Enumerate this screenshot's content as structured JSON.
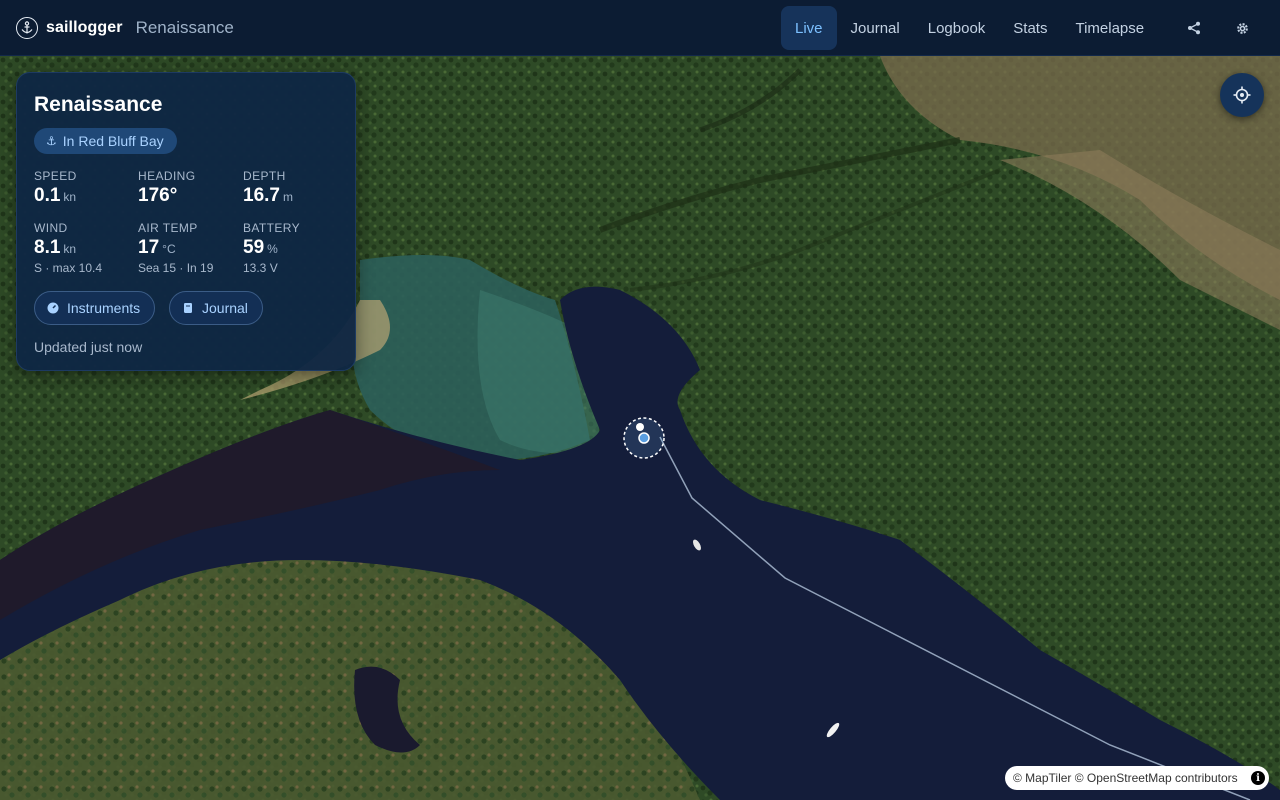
{
  "app": {
    "brand": "saillogger",
    "boat_name": "Renaissance"
  },
  "nav": {
    "items": [
      {
        "label": "Live",
        "active": true
      },
      {
        "label": "Journal",
        "active": false
      },
      {
        "label": "Logbook",
        "active": false
      },
      {
        "label": "Stats",
        "active": false
      },
      {
        "label": "Timelapse",
        "active": false
      }
    ],
    "icons": [
      "share-icon",
      "settings-icon"
    ]
  },
  "card": {
    "title": "Renaissance",
    "status": "In Red Bluff Bay",
    "metrics": {
      "speed": {
        "label": "SPEED",
        "value": "0.1",
        "unit": "kn"
      },
      "heading": {
        "label": "HEADING",
        "value": "176°",
        "unit": ""
      },
      "depth": {
        "label": "DEPTH",
        "value": "16.7",
        "unit": "m"
      },
      "wind": {
        "label": "WIND",
        "value": "8.1",
        "unit": "kn",
        "sub": "S · max 10.4"
      },
      "air_temp": {
        "label": "AIR TEMP",
        "value": "17",
        "unit": "°C",
        "sub": "Sea 15 · In 19"
      },
      "battery": {
        "label": "BATTERY",
        "value": "59",
        "unit": "%",
        "sub": "13.3 V"
      }
    },
    "buttons": {
      "instruments": "Instruments",
      "journal": "Journal"
    },
    "updated": "Updated just now"
  },
  "map": {
    "attribution": "© MapTiler © OpenStreetMap contributors",
    "locate_icon": "crosshair-icon",
    "accent": "#7cc0ff"
  }
}
